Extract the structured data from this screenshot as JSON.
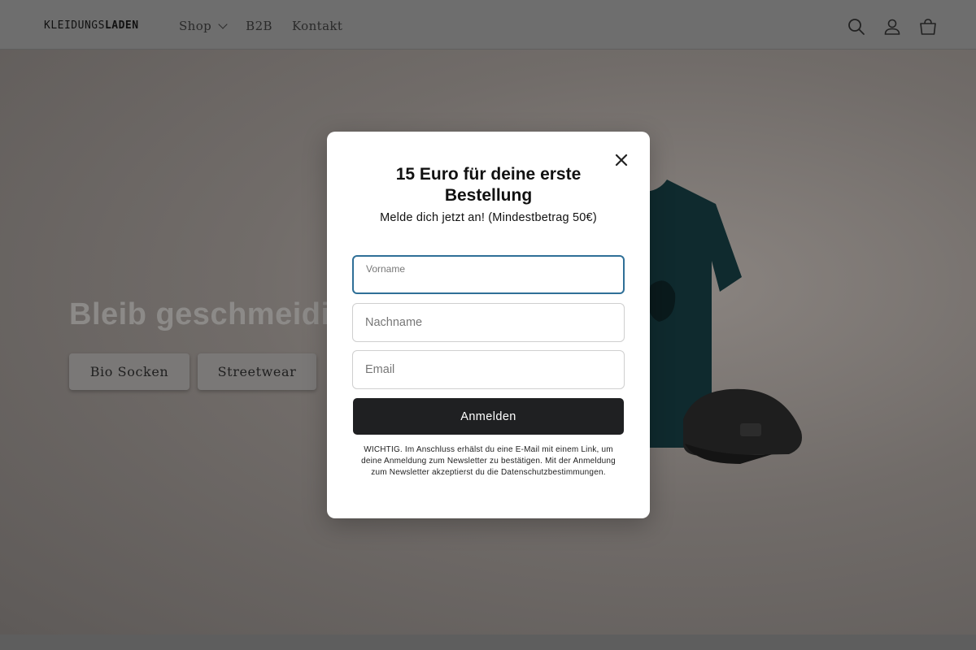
{
  "header": {
    "logo": {
      "light": "KLEIDUNGS",
      "bold": "LADEN"
    },
    "nav": [
      {
        "label": "Shop",
        "has_dropdown": true
      },
      {
        "label": "B2B",
        "has_dropdown": false
      },
      {
        "label": "Kontakt",
        "has_dropdown": false
      }
    ],
    "icons": [
      "search-icon",
      "account-icon",
      "cart-icon"
    ]
  },
  "hero": {
    "title": "Bleib geschmeidig",
    "buttons": [
      {
        "label": "Bio Socken"
      },
      {
        "label": "Streetwear"
      }
    ]
  },
  "modal": {
    "title": "15 Euro für deine erste Bestellung",
    "subtitle": "Melde dich jetzt an! (Mindestbetrag 50€)",
    "fields": {
      "first_name": {
        "label": "Vorname",
        "value": ""
      },
      "last_name": {
        "placeholder": "Nachname",
        "value": ""
      },
      "email": {
        "placeholder": "Email",
        "value": ""
      }
    },
    "submit_label": "Anmelden",
    "legal": "WICHTIG. Im Anschluss erhälst du eine E-Mail mit einem Link, um deine Anmeldung zum Newsletter zu bestätigen. Mit der Anmeldung zum Newsletter akzeptierst du die Datenschutzbestimmungen."
  },
  "colors": {
    "overlay_bg": "#6e6b68",
    "modal_bg": "#ffffff",
    "button_dark": "#1f2022",
    "focus_border": "#2f6f97"
  }
}
